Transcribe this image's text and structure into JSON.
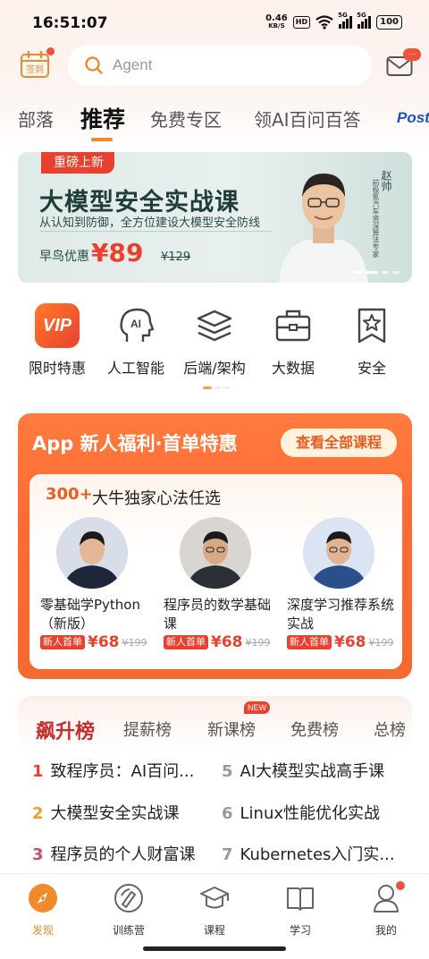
{
  "status_bar": {
    "time": "16:51:07",
    "net_speed": "0.46",
    "net_unit": "KB/S",
    "hd": "HD",
    "sim1": "5G",
    "sim2": "5G",
    "battery": "100"
  },
  "header": {
    "signin_label": "签到",
    "search_placeholder": "Agent",
    "mail_badge": "..."
  },
  "tabs": [
    {
      "label": "部落"
    },
    {
      "label": "推荐"
    },
    {
      "label": "免费专区"
    },
    {
      "label": "领AI百问百答"
    },
    {
      "label": "Post"
    }
  ],
  "banner": {
    "tag": "重磅上新",
    "title": "大模型安全实战课",
    "subtitle": "从认知到防御，全方位建设大模型安全防线",
    "price_label": "早鸟优惠",
    "price": "¥89",
    "old_price": "¥129",
    "teacher_name": "赵帅",
    "teacher_role": "前极氪汽车资深算法专家"
  },
  "categories": [
    {
      "label": "限时特惠",
      "icon": "vip-icon"
    },
    {
      "label": "人工智能",
      "icon": "ai-head-icon"
    },
    {
      "label": "后端/架构",
      "icon": "layers-icon"
    },
    {
      "label": "大数据",
      "icon": "briefcase-icon"
    },
    {
      "label": "安全",
      "icon": "shield-star-icon"
    }
  ],
  "promo": {
    "title": "App 新人福利·首单特惠",
    "button": "查看全部课程",
    "count": "300+",
    "count_text": "大牛独家心法任选",
    "courses": [
      {
        "name": "零基础学Python（新版）",
        "tag": "新人首单",
        "price": "¥68",
        "old_price": "¥199"
      },
      {
        "name": "程序员的数学基础课",
        "tag": "新人首单",
        "price": "¥68",
        "old_price": "¥199"
      },
      {
        "name": "深度学习推荐系统实战",
        "tag": "新人首单",
        "price": "¥68",
        "old_price": "¥199"
      }
    ]
  },
  "ranking": {
    "tabs": [
      "飙升榜",
      "提薪榜",
      "新课榜",
      "免费榜",
      "总榜"
    ],
    "new_badge": "NEW",
    "items": [
      {
        "no": "1",
        "title": "致程序员：AI百问..."
      },
      {
        "no": "5",
        "title": "AI大模型实战高手课"
      },
      {
        "no": "2",
        "title": "大模型安全实战课"
      },
      {
        "no": "6",
        "title": "Linux性能优化实战"
      },
      {
        "no": "3",
        "title": "程序员的个人财富课"
      },
      {
        "no": "7",
        "title": "Kubernetes入门实..."
      }
    ]
  },
  "bottom_nav": [
    {
      "label": "发现"
    },
    {
      "label": "训练营"
    },
    {
      "label": "课程"
    },
    {
      "label": "学习"
    },
    {
      "label": "我的"
    }
  ],
  "colors": {
    "accent": "#f08a2a",
    "price_red": "#e8412e",
    "promo_orange": "#ff6a35",
    "rank_red": "#c52e2e"
  }
}
